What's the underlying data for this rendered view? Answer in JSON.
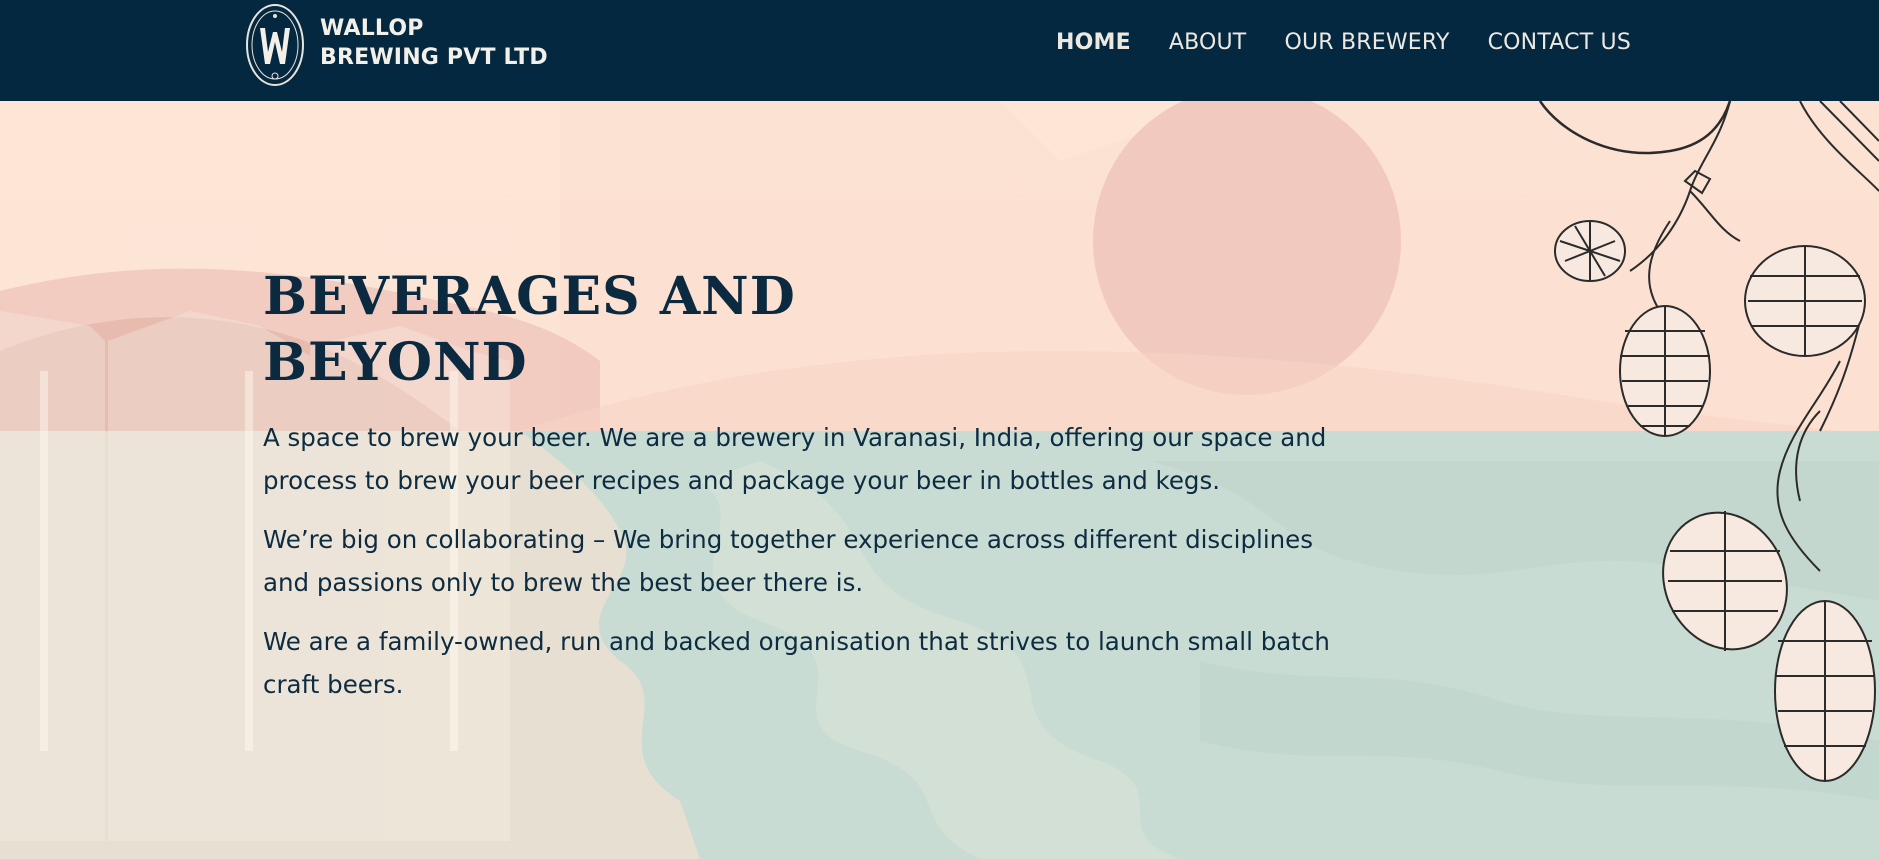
{
  "header": {
    "brand_line1": "WALLOP",
    "brand_line2": "BREWING PVT LTD",
    "nav": [
      {
        "label": "HOME"
      },
      {
        "label": "ABOUT"
      },
      {
        "label": "OUR BREWERY"
      },
      {
        "label": "CONTACT US"
      }
    ]
  },
  "hero": {
    "title_line1": "BEVERAGES AND",
    "title_line2": "BEYOND",
    "paragraphs": [
      "A space to brew your beer. We are a brewery in Varanasi, India, offering our space and process to brew your beer recipes and package your beer in bottles and kegs.",
      "We’re big on collaborating – We bring together experience across different disciplines and passions only to brew the best beer there is.",
      "We are a family-owned, run and backed organisation that strives to launch small batch craft beers."
    ]
  },
  "colors": {
    "navbar": "#052841",
    "text": "#0b2a40",
    "sky": "#fde7d9",
    "sun": "#f2c9bf",
    "water": "#c9dcd3"
  }
}
